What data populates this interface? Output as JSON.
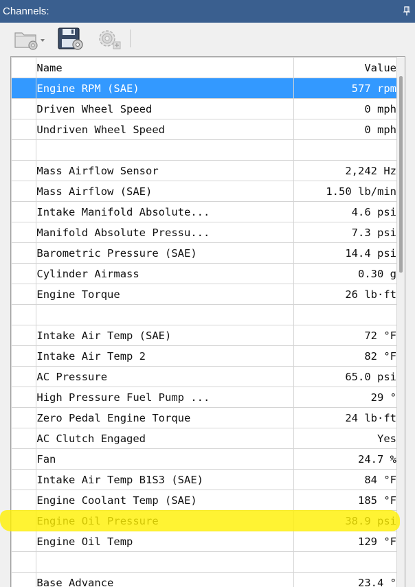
{
  "panel": {
    "title": "Channels:",
    "pin_icon": "pin-icon"
  },
  "toolbar": {
    "buttons": [
      {
        "name": "open-folder-button",
        "icon": "folder-gear-icon"
      },
      {
        "name": "save-button",
        "icon": "floppy-gear-icon"
      },
      {
        "name": "settings-button",
        "icon": "gear-add-icon"
      }
    ]
  },
  "table": {
    "headers": {
      "name": "Name",
      "value": "Value"
    },
    "rows": [
      {
        "name": "Engine RPM (SAE)",
        "value": "577 rpm",
        "selected": true
      },
      {
        "name": "Driven Wheel Speed",
        "value": "0 mph"
      },
      {
        "name": "Undriven Wheel Speed",
        "value": "0 mph"
      },
      {
        "name": "",
        "value": ""
      },
      {
        "name": "Mass Airflow Sensor",
        "value": "2,242 Hz"
      },
      {
        "name": "Mass Airflow (SAE)",
        "value": "1.50 lb/min"
      },
      {
        "name": "Intake Manifold Absolute...",
        "value": "4.6 psi"
      },
      {
        "name": "Manifold Absolute Pressu...",
        "value": "7.3 psi"
      },
      {
        "name": "Barometric Pressure (SAE)",
        "value": "14.4 psi"
      },
      {
        "name": "Cylinder Airmass",
        "value": "0.30 g"
      },
      {
        "name": "Engine Torque",
        "value": "26 lb·ft"
      },
      {
        "name": "",
        "value": ""
      },
      {
        "name": "Intake Air Temp (SAE)",
        "value": "72 °F"
      },
      {
        "name": "Intake Air Temp 2",
        "value": "82 °F"
      },
      {
        "name": "AC Pressure",
        "value": "65.0 psi"
      },
      {
        "name": "High Pressure Fuel Pump ...",
        "value": "29 °"
      },
      {
        "name": "Zero Pedal Engine Torque",
        "value": "24 lb·ft"
      },
      {
        "name": "AC Clutch Engaged",
        "value": "Yes"
      },
      {
        "name": "Fan",
        "value": "24.7 %"
      },
      {
        "name": "Intake Air Temp B1S3 (SAE)",
        "value": "84 °F"
      },
      {
        "name": "Engine Coolant Temp (SAE)",
        "value": "185 °F"
      },
      {
        "name": "Engine Oil Pressure",
        "value": "38.9 psi",
        "highlighted": true
      },
      {
        "name": "Engine Oil Temp",
        "value": "129 °F"
      },
      {
        "name": "",
        "value": ""
      },
      {
        "name": "Base Advance",
        "value": "23.4 °"
      }
    ]
  },
  "colors": {
    "titlebar": "#3a5f8f",
    "selection": "#3399ff",
    "highlight_marker": "#fff000"
  }
}
